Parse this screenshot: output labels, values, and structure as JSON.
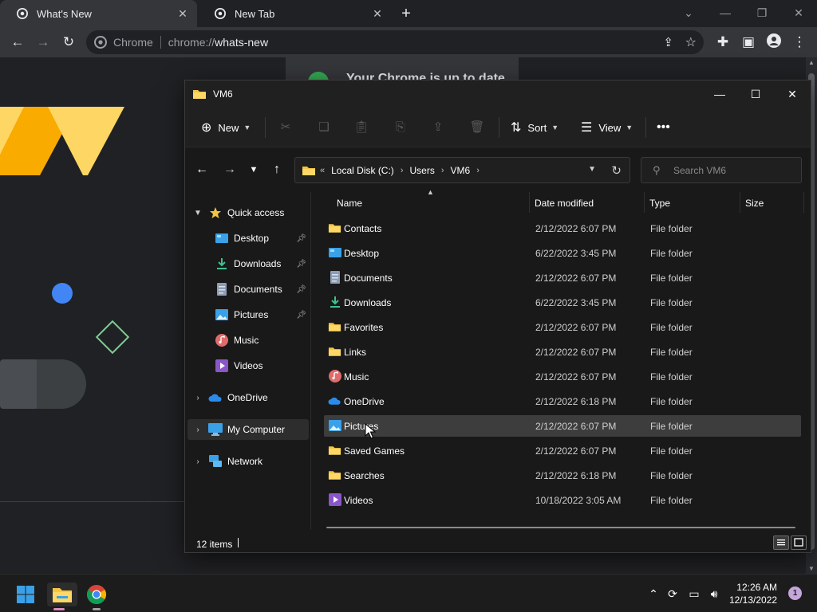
{
  "browser": {
    "tabs": [
      {
        "title": "What's New",
        "active": true
      },
      {
        "title": "New Tab",
        "active": false
      }
    ],
    "omnibox": {
      "site_label": "Chrome",
      "url_scheme": "chrome://",
      "url_path": "whats-new"
    },
    "page_notice": "Your Chrome is up to date"
  },
  "explorer": {
    "title": "VM6",
    "commands": {
      "new": "New",
      "sort": "Sort",
      "view": "View"
    },
    "breadcrumb": [
      "Local Disk (C:)",
      "Users",
      "VM6"
    ],
    "search_placeholder": "Search VM6",
    "nav_pane": {
      "quick_access": "Quick access",
      "quick_items": [
        {
          "label": "Desktop",
          "pinned": true
        },
        {
          "label": "Downloads",
          "pinned": true
        },
        {
          "label": "Documents",
          "pinned": true
        },
        {
          "label": "Pictures",
          "pinned": true
        },
        {
          "label": "Music",
          "pinned": false
        },
        {
          "label": "Videos",
          "pinned": false
        }
      ],
      "onedrive": "OneDrive",
      "my_computer": "My Computer",
      "network": "Network"
    },
    "columns": {
      "name": "Name",
      "date": "Date modified",
      "type": "Type",
      "size": "Size"
    },
    "rows": [
      {
        "name": "Contacts",
        "date": "2/12/2022 6:07 PM",
        "type": "File folder",
        "icon": "folder-icon"
      },
      {
        "name": "Desktop",
        "date": "6/22/2022 3:45 PM",
        "type": "File folder",
        "icon": "desktop-icon"
      },
      {
        "name": "Documents",
        "date": "2/12/2022 6:07 PM",
        "type": "File folder",
        "icon": "document-icon"
      },
      {
        "name": "Downloads",
        "date": "6/22/2022 3:45 PM",
        "type": "File folder",
        "icon": "download-icon"
      },
      {
        "name": "Favorites",
        "date": "2/12/2022 6:07 PM",
        "type": "File folder",
        "icon": "folder-icon"
      },
      {
        "name": "Links",
        "date": "2/12/2022 6:07 PM",
        "type": "File folder",
        "icon": "folder-icon"
      },
      {
        "name": "Music",
        "date": "2/12/2022 6:07 PM",
        "type": "File folder",
        "icon": "music-icon"
      },
      {
        "name": "OneDrive",
        "date": "2/12/2022 6:18 PM",
        "type": "File folder",
        "icon": "cloud-icon"
      },
      {
        "name": "Pictures",
        "date": "2/12/2022 6:07 PM",
        "type": "File folder",
        "icon": "pictures-icon",
        "selected": true
      },
      {
        "name": "Saved Games",
        "date": "2/12/2022 6:07 PM",
        "type": "File folder",
        "icon": "folder-icon"
      },
      {
        "name": "Searches",
        "date": "2/12/2022 6:18 PM",
        "type": "File folder",
        "icon": "folder-icon"
      },
      {
        "name": "Videos",
        "date": "10/18/2022 3:05 AM",
        "type": "File folder",
        "icon": "videos-icon"
      }
    ],
    "status": {
      "item_count": "12 items"
    }
  },
  "taskbar": {
    "time": "12:26 AM",
    "date": "12/13/2022",
    "notification_count": "1"
  },
  "colors": {
    "folder": "#f4c542",
    "accent_blue": "#4285f4",
    "chrome_bg": "#202124",
    "explorer_bg": "#191919"
  }
}
